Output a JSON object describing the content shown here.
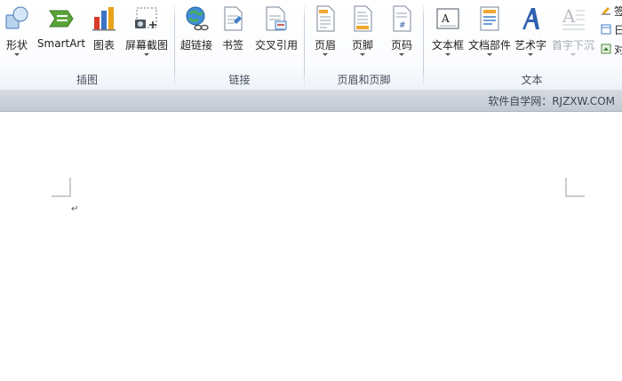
{
  "ribbon": {
    "groups": [
      {
        "title": "插图",
        "buttons": [
          {
            "label": "形状",
            "icon": "shapes-icon"
          },
          {
            "label": "SmartArt",
            "icon": "smartart-icon"
          },
          {
            "label": "图表",
            "icon": "chart-icon"
          },
          {
            "label": "屏幕截图",
            "icon": "screenshot-icon"
          }
        ]
      },
      {
        "title": "链接",
        "buttons": [
          {
            "label": "超链接",
            "icon": "hyperlink-icon"
          },
          {
            "label": "书签",
            "icon": "bookmark-icon"
          },
          {
            "label": "交叉引用",
            "icon": "cross-reference-icon"
          }
        ]
      },
      {
        "title": "页眉和页脚",
        "buttons": [
          {
            "label": "页眉",
            "icon": "header-icon"
          },
          {
            "label": "页脚",
            "icon": "footer-icon"
          },
          {
            "label": "页码",
            "icon": "page-number-icon"
          }
        ]
      },
      {
        "title": "文本",
        "buttons": [
          {
            "label": "文本框",
            "icon": "text-box-icon"
          },
          {
            "label": "文档部件",
            "icon": "quick-parts-icon"
          },
          {
            "label": "艺术字",
            "icon": "wordart-icon"
          },
          {
            "label": "首字下沉",
            "icon": "drop-cap-icon",
            "disabled": true
          }
        ]
      }
    ],
    "small_buttons": [
      {
        "label": "签",
        "icon": "signature-line-icon"
      },
      {
        "label": "日",
        "icon": "date-time-icon"
      },
      {
        "label": "对",
        "icon": "object-icon"
      }
    ],
    "colors": {
      "accent": "#2b579a",
      "ribbon_bg": "#ffffff",
      "status_bg": "#c9ced6"
    }
  },
  "statusbar": {
    "watermark": "软件自学网：RJZXW.COM"
  },
  "document": {
    "paragraph_mark": "↵"
  }
}
